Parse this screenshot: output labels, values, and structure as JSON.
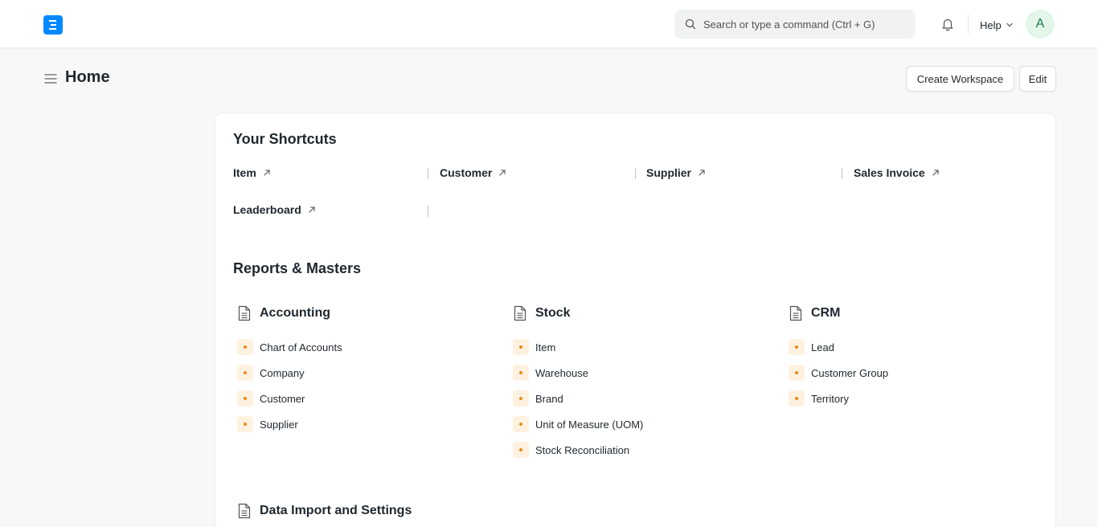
{
  "navbar": {
    "logo_letter": "E",
    "search_placeholder": "Search or type a command (Ctrl + G)",
    "help_label": "Help",
    "avatar_initial": "A"
  },
  "page": {
    "title": "Home",
    "create_workspace_label": "Create Workspace",
    "edit_label": "Edit"
  },
  "shortcuts": {
    "title": "Your Shortcuts",
    "items": [
      "Item",
      "Customer",
      "Supplier",
      "Sales Invoice",
      "Leaderboard"
    ]
  },
  "reports": {
    "title": "Reports & Masters",
    "columns": [
      {
        "title": "Accounting",
        "links": [
          "Chart of Accounts",
          "Company",
          "Customer",
          "Supplier"
        ]
      },
      {
        "title": "Stock",
        "links": [
          "Item",
          "Warehouse",
          "Brand",
          "Unit of Measure (UOM)",
          "Stock Reconciliation"
        ]
      },
      {
        "title": "CRM",
        "links": [
          "Lead",
          "Customer Group",
          "Territory"
        ]
      }
    ],
    "next_section_title": "Data Import and Settings"
  },
  "colors": {
    "brand": "#0089ff",
    "dot": "#e88b1a",
    "dot_bg": "#fff1e0",
    "avatar_bg": "#e4f5e9",
    "avatar_text": "#16794c"
  }
}
